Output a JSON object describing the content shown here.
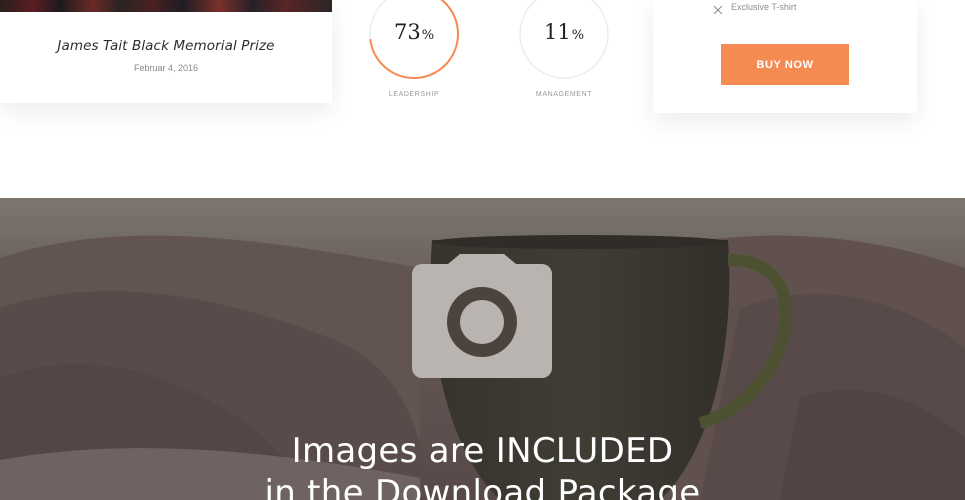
{
  "news_card": {
    "title": "James Tait Black Memorial Prize",
    "date": "Februar 4, 2016"
  },
  "stats": [
    {
      "value": "73",
      "unit": "%",
      "label": "LEADERSHIP",
      "percent": 73
    },
    {
      "value": "11",
      "unit": "%",
      "label": "MANAGEMENT",
      "percent": 11
    }
  ],
  "pricing": {
    "feature_excluded": "Exclusive T-shirt",
    "feature_icon": "x-icon",
    "buy_label": "BUY NOW"
  },
  "hero": {
    "caption_line1": "Images are INCLUDED",
    "caption_line2": "in the Download Package",
    "placeholder_icon": "camera-icon"
  },
  "colors": {
    "accent": "#f58a52",
    "ring_track": "#ececec"
  }
}
